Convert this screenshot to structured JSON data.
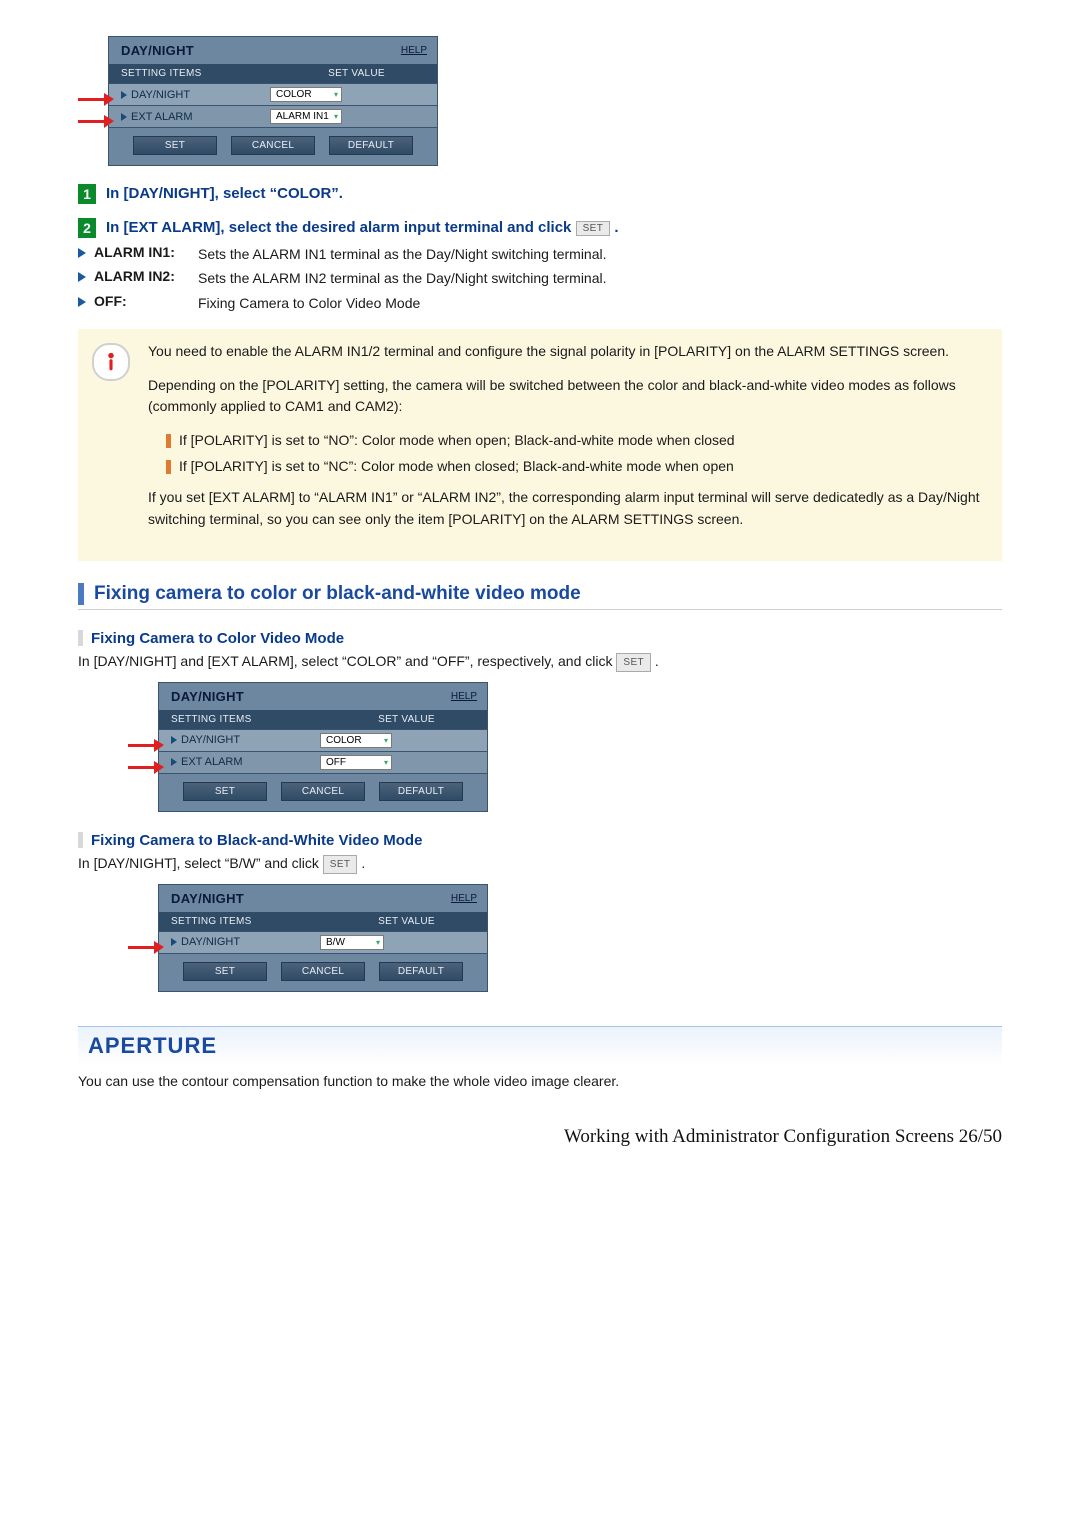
{
  "panel1": {
    "title": "DAY/NIGHT",
    "help": "HELP",
    "col_left": "SETTING ITEMS",
    "col_right": "SET VALUE",
    "rows": [
      {
        "label": "DAY/NIGHT",
        "value": "COLOR",
        "arrow": true
      },
      {
        "label": "EXT ALARM",
        "value": "ALARM IN1",
        "arrow": true
      }
    ],
    "buttons": {
      "set": "SET",
      "cancel": "CANCEL",
      "default": "DEFAULT"
    }
  },
  "step1": {
    "num": "1",
    "text": "In [DAY/NIGHT], select “COLOR”."
  },
  "step2": {
    "num": "2",
    "text_pre": "In [EXT ALARM], select the desired alarm input terminal and click ",
    "btn": "SET",
    "text_post": " ."
  },
  "defs": [
    {
      "term": "ALARM IN1:",
      "desc": "Sets the ALARM IN1 terminal as the Day/Night switching terminal."
    },
    {
      "term": "ALARM IN2:",
      "desc": "Sets the ALARM IN2 terminal as the Day/Night switching terminal."
    },
    {
      "term": "OFF:",
      "desc": "Fixing Camera to Color Video Mode"
    }
  ],
  "note": {
    "p1": "You need to enable the ALARM IN1/2 terminal and configure the signal polarity in [POLARITY] on the ALARM SETTINGS screen.",
    "p2": "Depending on the [POLARITY] setting, the camera will be switched between the color and black-and-white video modes as follows (commonly applied to CAM1 and CAM2):",
    "b1": "If [POLARITY] is set to “NO”: Color mode when open; Black-and-white mode when closed",
    "b2": "If [POLARITY] is set to “NC”: Color mode when closed; Black-and-white mode when open",
    "p3": "If you set [EXT ALARM] to “ALARM IN1” or “ALARM IN2”, the corresponding alarm input terminal will serve dedicatedly as a Day/Night switching terminal, so you can see only the item [POLARITY] on the ALARM SETTINGS screen."
  },
  "sec_fix": "Fixing camera to color or black-and-white video mode",
  "sec_color": "Fixing Camera to Color Video Mode",
  "sec_color_p_pre": "In [DAY/NIGHT] and [EXT ALARM], select “COLOR” and “OFF”, respectively, and click ",
  "sec_color_btn": "SET",
  "sec_color_p_post": " .",
  "panel2": {
    "title": "DAY/NIGHT",
    "help": "HELP",
    "col_left": "SETTING ITEMS",
    "col_right": "SET VALUE",
    "rows": [
      {
        "label": "DAY/NIGHT",
        "value": "COLOR",
        "arrow": true
      },
      {
        "label": "EXT ALARM",
        "value": "OFF",
        "arrow": true
      }
    ],
    "buttons": {
      "set": "SET",
      "cancel": "CANCEL",
      "default": "DEFAULT"
    }
  },
  "sec_bw": "Fixing Camera to Black-and-White Video Mode",
  "sec_bw_p_pre": "In [DAY/NIGHT], select “B/W” and click ",
  "sec_bw_btn": "SET",
  "sec_bw_p_post": " .",
  "panel3": {
    "title": "DAY/NIGHT",
    "help": "HELP",
    "col_left": "SETTING ITEMS",
    "col_right": "SET VALUE",
    "rows": [
      {
        "label": "DAY/NIGHT",
        "value": "B/W",
        "arrow": true
      }
    ],
    "buttons": {
      "set": "SET",
      "cancel": "CANCEL",
      "default": "DEFAULT"
    }
  },
  "aperture_head": "APERTURE",
  "aperture_p": "You can use the contour compensation function to make the whole video image clearer.",
  "footer": "Working with Administrator Configuration Screens 26/50"
}
